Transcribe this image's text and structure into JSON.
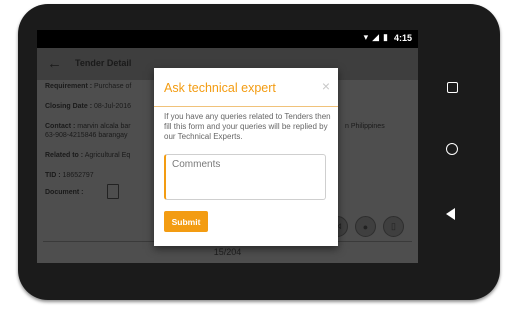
{
  "status_bar": {
    "time": "4:15",
    "wifi_icon": "wifi-icon",
    "signal_icon": "signal-icon",
    "battery_icon": "battery-icon"
  },
  "app_bar": {
    "title": "Tender Detail",
    "back_icon": "arrow-back-icon"
  },
  "details": {
    "requirement_label": "Requirement :",
    "requirement_value": "Purchase of",
    "closing_label": "Closing Date :",
    "closing_value": "08-Jul-2016",
    "contact_label": "Contact :",
    "contact_value_1": "marvin alcala bar",
    "contact_value_suffix": "n Philippines",
    "contact_value_2": "63-908-4215846 barangay",
    "related_label": "Related to :",
    "related_value": "Agricultural Eq",
    "tid_label": "TID :",
    "tid_value": "18652797",
    "document_label": "Document :"
  },
  "action_icons": [
    "share-icon",
    "person-icon",
    "trash-icon"
  ],
  "pager": {
    "text": "15/204"
  },
  "dialog": {
    "title": "Ask technical expert",
    "close": "×",
    "message": "If you have any queries related to Tenders then fill this form and your queries will be replied by our Technical Experts.",
    "comments_placeholder": "Comments",
    "comments_value": "",
    "submit_label": "Submit"
  },
  "nav_bar": {
    "items": [
      "recents-icon",
      "home-icon",
      "back-icon"
    ]
  },
  "colors": {
    "accent": "#f39c12",
    "dim_overlay": "#4e4e4e"
  }
}
